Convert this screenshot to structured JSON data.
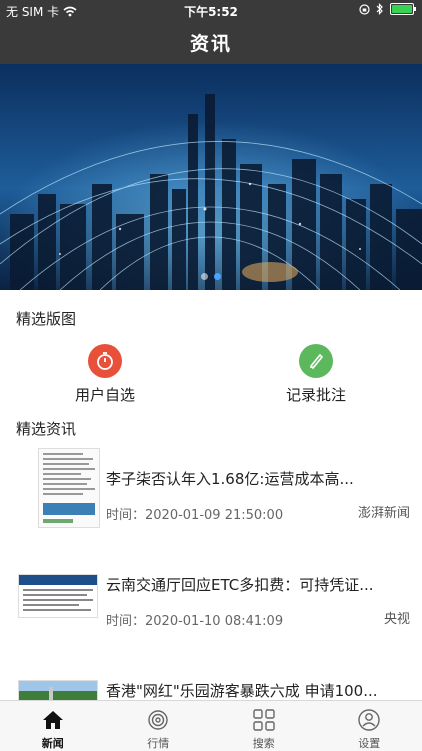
{
  "status_bar": {
    "carrier": "无 SIM 卡",
    "time": "下午5:52",
    "battery_level": 1.0
  },
  "nav": {
    "title": "资讯"
  },
  "banner": {
    "slides": 2,
    "active_slide": 1
  },
  "featured": {
    "title": "精选版图",
    "items": [
      {
        "label": "用户自选",
        "icon": "stopwatch-icon",
        "color": "#e8503a"
      },
      {
        "label": "记录批注",
        "icon": "pen-icon",
        "color": "#5cb85c"
      }
    ]
  },
  "news_section": {
    "title": "精选资讯",
    "time_prefix": "时间：",
    "items": [
      {
        "title": "李子柒否认年入1.68亿:运营成本高...",
        "time": "2020-01-09 21:50:00",
        "source": "澎湃新闻"
      },
      {
        "title": "云南交通厅回应ETC多扣费：可持凭证...",
        "time": "2020-01-10 08:41:09",
        "source": "央视"
      },
      {
        "title": "香港\"网红\"乐园游客暴跌六成 申请100..."
      }
    ]
  },
  "tabbar": {
    "tabs": [
      {
        "label": "新闻",
        "icon": "home-icon",
        "active": true
      },
      {
        "label": "行情",
        "icon": "radar-icon",
        "active": false
      },
      {
        "label": "搜索",
        "icon": "grid-icon",
        "active": false
      },
      {
        "label": "设置",
        "icon": "user-icon",
        "active": false
      }
    ]
  }
}
